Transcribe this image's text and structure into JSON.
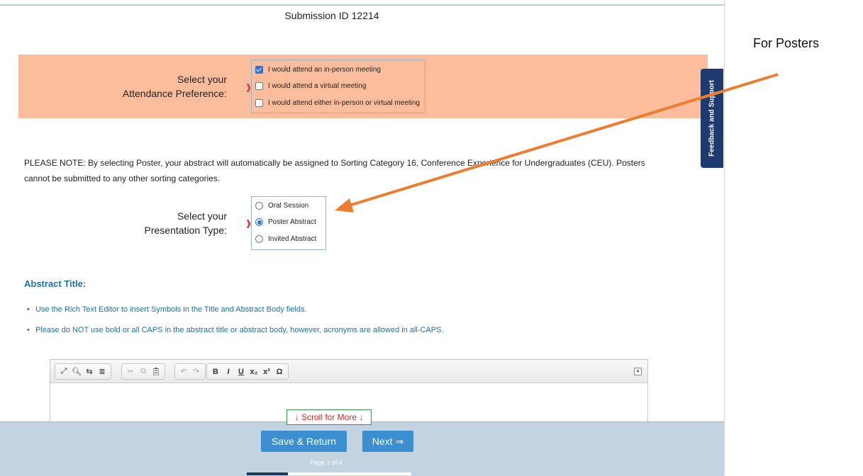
{
  "submission_id": "Submission ID 12214",
  "attendance": {
    "label_line1": "Select your",
    "label_line2": "Attendance Preference:",
    "options": [
      {
        "label": "I would attend an in-person meeting",
        "checked": true
      },
      {
        "label": "I would attend a virtual meeting",
        "checked": false
      },
      {
        "label": "I would attend either in-person or virtual meeting",
        "checked": false
      }
    ]
  },
  "note": "PLEASE NOTE: By selecting Poster, your abstract will automatically be assigned to Sorting Category 16, Conference Experience for Undergraduates (CEU). Posters cannot be submitted to any other sorting categories.",
  "presentation": {
    "label_line1": "Select your",
    "label_line2": "Presentation Type:",
    "options": [
      {
        "label": "Oral Session",
        "selected": false
      },
      {
        "label": "Poster Abstract",
        "selected": true
      },
      {
        "label": "Invited Abstract",
        "selected": false
      }
    ]
  },
  "abstract_title": {
    "heading": "Abstract Title:",
    "bullets": [
      "Use the Rich Text Editor to insert Symbols in the Title and Abstract Body fields.",
      "Please do NOT use bold or all CAPS in the abstract title or abstract body, however, acronyms are allowed in all-CAPS."
    ]
  },
  "editor_toolbar": {
    "icons": [
      "maximize-icon",
      "find-icon",
      "replace-icon",
      "show-blocks-icon",
      "cut-icon",
      "copy-icon",
      "paste-icon",
      "undo-icon",
      "redo-icon",
      "bold-icon",
      "italic-icon",
      "underline-icon",
      "subscript-icon",
      "superscript-icon",
      "special-char-icon"
    ],
    "glyphs": {
      "bold": "B",
      "italic": "I",
      "underline": "U",
      "subscript": "x₂",
      "superscript": "x²",
      "omega": "Ω"
    }
  },
  "scroll_for_more": "↓ Scroll for More ↓",
  "buttons": {
    "save_return": "Save & Return",
    "next": "Next ⇒"
  },
  "page_indicator": "Page 1 of 4",
  "progress_fraction": 0.25,
  "feedback_tab": "Feedback and Support",
  "annotation": {
    "text": "For Posters",
    "arrow_color": "#ed7d31"
  },
  "colors": {
    "attendance_band": "#fbbd9b",
    "accent_blue": "#1f6fa8",
    "button_blue": "#3b8fd0",
    "footer_bg": "#c3d4e0",
    "feedback_tab": "#1e3a6e"
  }
}
